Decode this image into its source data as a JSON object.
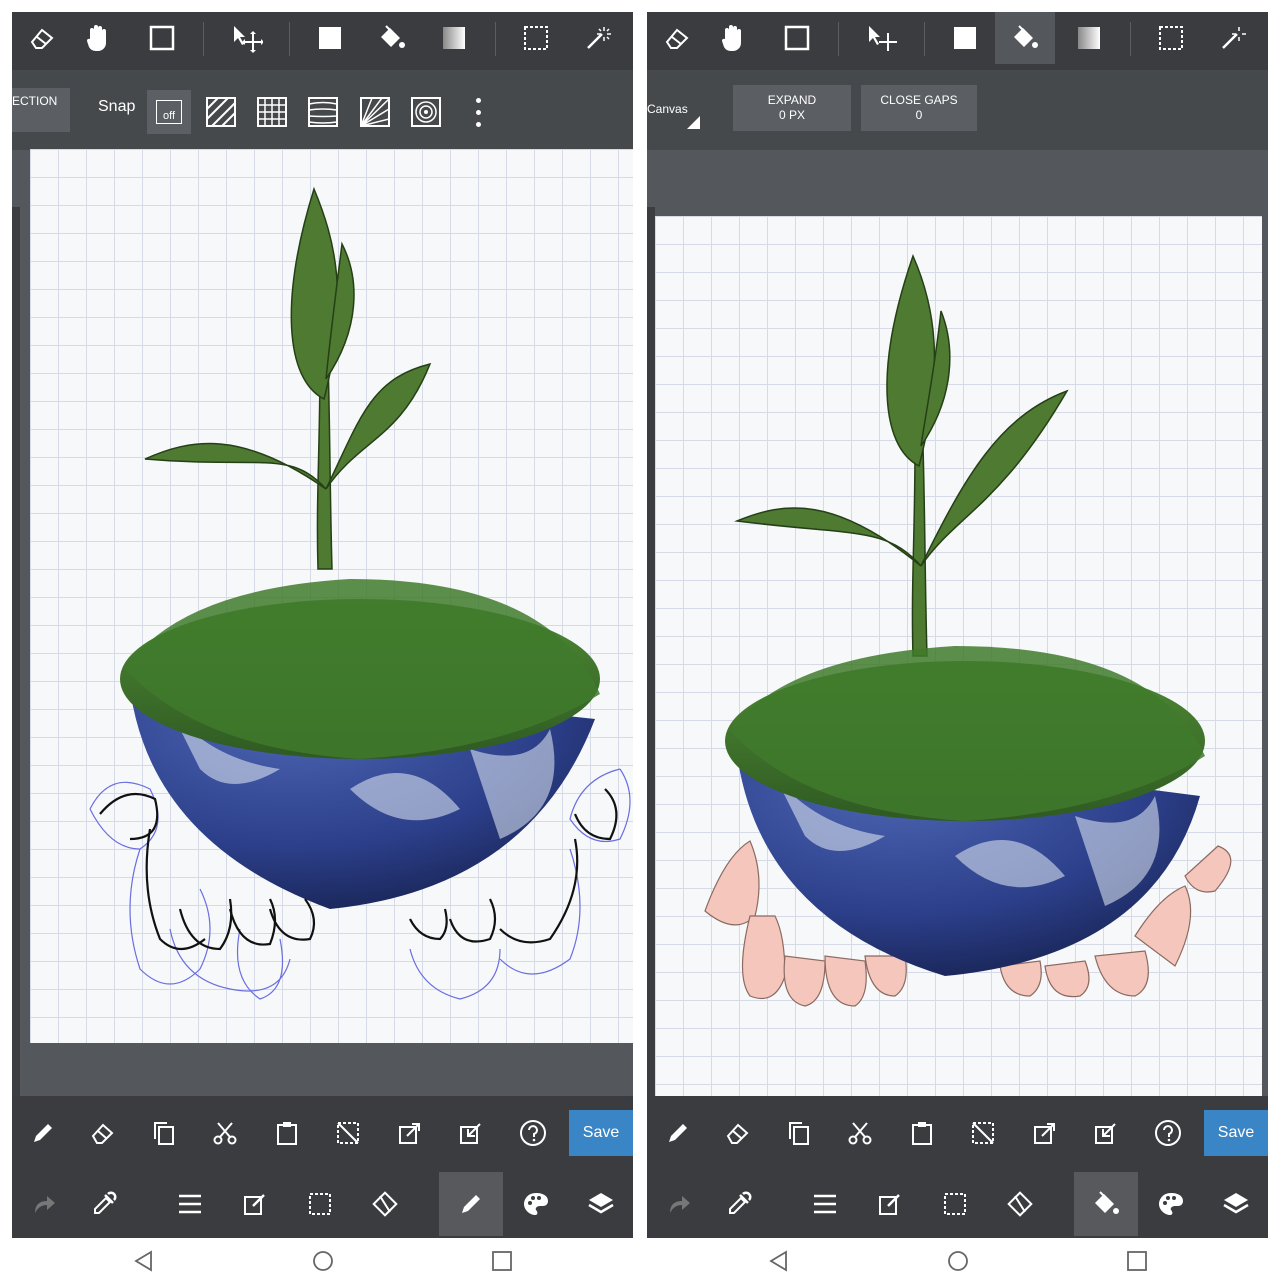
{
  "left_panel": {
    "selection_button_label": "ECTION",
    "snap_label": "Snap",
    "snap_off_label": "off",
    "save_label": "Save"
  },
  "right_panel": {
    "canvas_label": "Canvas",
    "expand": {
      "label": "EXPAND",
      "value": "0 PX"
    },
    "close_gaps": {
      "label": "CLOSE GAPS",
      "value": "0"
    },
    "save_label": "Save"
  },
  "top_tools": [
    "eraser-icon",
    "hand-icon",
    "rectangle-icon",
    "move-icon",
    "fill-square-icon",
    "bucket-icon",
    "gradient-icon",
    "marquee-icon",
    "magic-wand-icon"
  ],
  "bottom_tools_1": [
    "pen-icon",
    "eraser-icon",
    "copy-icon",
    "cut-icon",
    "paste-icon",
    "deselect-icon",
    "export-icon",
    "import-icon",
    "help-icon"
  ],
  "bottom_tools_2": [
    "redo-icon",
    "eyedropper-icon",
    "menu-icon",
    "edit-icon",
    "selection-icon",
    "transform-icon",
    "brush-icon",
    "palette-icon",
    "layers-icon"
  ],
  "colors": {
    "toolbar": "#3a3c3f",
    "accent_save": "#3a85c5",
    "leaf": "#4f7a32",
    "hand_fill": "#f5c6bc",
    "sketch_blue": "#6a6ee0"
  }
}
